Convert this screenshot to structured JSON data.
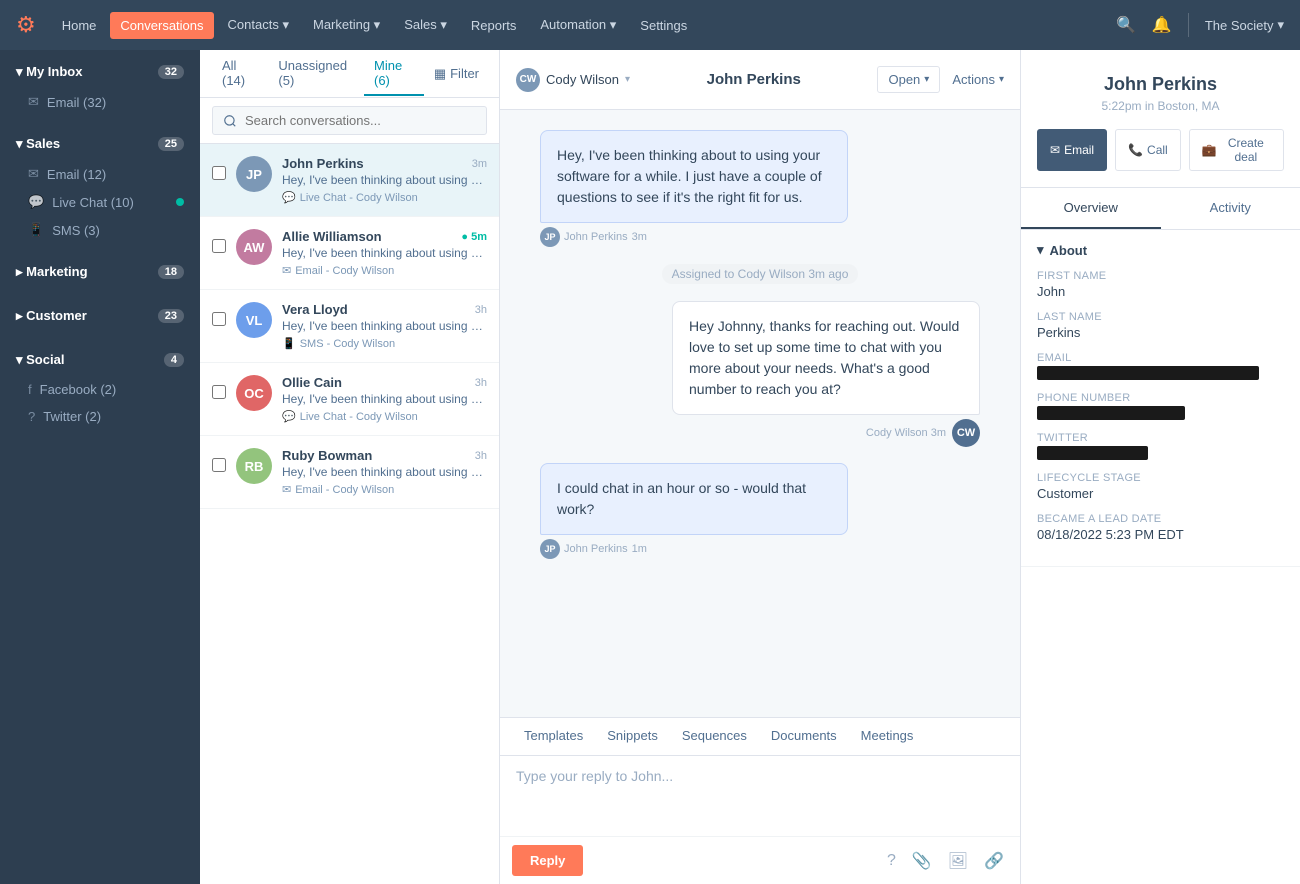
{
  "nav": {
    "logo": "🟠",
    "items": [
      "Home",
      "Conversations",
      "Contacts",
      "Marketing",
      "Sales",
      "Reports",
      "Automation",
      "Settings"
    ],
    "active_item": "Conversations",
    "company": "The Society"
  },
  "sidebar": {
    "sections": [
      {
        "title": "My Inbox",
        "count": 32,
        "expanded": true,
        "items": [
          {
            "icon": "✉",
            "label": "Email",
            "count": 32,
            "online": false
          }
        ]
      },
      {
        "title": "Sales",
        "count": 25,
        "expanded": true,
        "items": [
          {
            "icon": "✉",
            "label": "Email",
            "count": 12,
            "online": false
          },
          {
            "icon": "💬",
            "label": "Live Chat",
            "count": 10,
            "online": true
          },
          {
            "icon": "📱",
            "label": "SMS",
            "count": 3,
            "online": false
          }
        ]
      },
      {
        "title": "Marketing",
        "count": 18,
        "expanded": false,
        "items": []
      },
      {
        "title": "Customer",
        "count": 23,
        "expanded": false,
        "items": []
      },
      {
        "title": "Social",
        "count": 4,
        "expanded": true,
        "items": [
          {
            "icon": "f",
            "label": "Facebook",
            "count": 2,
            "online": false
          },
          {
            "icon": "?",
            "label": "Twitter",
            "count": 2,
            "online": false
          }
        ]
      }
    ]
  },
  "conv_tabs": [
    {
      "label": "All",
      "count": 14
    },
    {
      "label": "Unassigned",
      "count": 5
    },
    {
      "label": "Mine",
      "count": 6
    }
  ],
  "search": {
    "placeholder": "Search conversations..."
  },
  "conversations": [
    {
      "name": "John Perkins",
      "time": "3m",
      "preview": "Hey, I've been thinking about using your software for a while. I just ha...",
      "channel": "Live Chat - Cody Wilson",
      "channel_icon": "💬",
      "avatar_color": "#7c98b6",
      "initials": "JP",
      "active": true,
      "online": false
    },
    {
      "name": "Allie Williamson",
      "time": "5m",
      "preview": "Hey, I've been thinking about using your software for a while. I just ha...",
      "channel": "Email - Cody Wilson",
      "channel_icon": "✉",
      "avatar_color": "#c27ba0",
      "initials": "AW",
      "active": false,
      "online": true
    },
    {
      "name": "Vera Lloyd",
      "time": "3h",
      "preview": "Hey, I've been thinking about using your software for a while. I just ha...",
      "channel": "SMS - Cody Wilson",
      "channel_icon": "📱",
      "avatar_color": "#6d9eeb",
      "initials": "VL",
      "active": false,
      "online": false
    },
    {
      "name": "Ollie Cain",
      "time": "3h",
      "preview": "Hey, I've been thinking about using your software for a while. I just ha...",
      "channel": "Live Chat - Cody Wilson",
      "channel_icon": "💬",
      "avatar_color": "#e06666",
      "initials": "OC",
      "active": false,
      "online": false
    },
    {
      "name": "Ruby Bowman",
      "time": "3h",
      "preview": "Hey, I've been thinking about using your software for a while. I just ha...",
      "channel": "Email - Cody Wilson",
      "channel_icon": "✉",
      "avatar_color": "#93c47d",
      "initials": "RB",
      "active": false,
      "online": false
    }
  ],
  "conv_header": {
    "assigned_to": "Cody Wilson",
    "contact_name": "John Perkins",
    "status": "Open",
    "actions": "Actions"
  },
  "messages": [
    {
      "type": "incoming",
      "text": "Hey, I've been thinking about to using your software for a while. I just have a couple of questions to see if it's the right fit for us.",
      "sender": "John Perkins",
      "time": "3m",
      "highlighted": true
    },
    {
      "type": "assigned",
      "text": "Assigned to Cody Wilson 3m ago"
    },
    {
      "type": "outgoing",
      "text": "Hey Johnny, thanks for reaching out. Would love to set up some time to chat with you more about your needs. What's a good number to reach you at?",
      "sender": "Cody Wilson",
      "time": "3m"
    },
    {
      "type": "incoming",
      "text": "I could chat in an hour or so - would that work?",
      "sender": "John Perkins",
      "time": "1m",
      "highlighted": false
    }
  ],
  "reply": {
    "tabs": [
      "Templates",
      "Snippets",
      "Sequences",
      "Documents",
      "Meetings"
    ],
    "placeholder": "Type your reply to John...",
    "button_label": "Reply"
  },
  "contact": {
    "name": "John Perkins",
    "time": "5:22pm in Boston, MA",
    "actions": [
      "Email",
      "Call",
      "Create deal"
    ],
    "tabs": [
      "Overview",
      "Activity"
    ],
    "about_title": "About",
    "fields": [
      {
        "label": "First name",
        "value": "John",
        "redacted": false
      },
      {
        "label": "Last Name",
        "value": "Perkins",
        "redacted": false
      },
      {
        "label": "Email",
        "value": "",
        "redacted": true
      },
      {
        "label": "Phone Number",
        "value": "",
        "redacted": true
      },
      {
        "label": "Twitter",
        "value": "",
        "redacted": true
      },
      {
        "label": "Lifecycle Stage",
        "value": "Customer",
        "redacted": false
      },
      {
        "label": "Became a Lead Date",
        "value": "08/18/2022 5:23 PM EDT",
        "redacted": false
      }
    ]
  }
}
